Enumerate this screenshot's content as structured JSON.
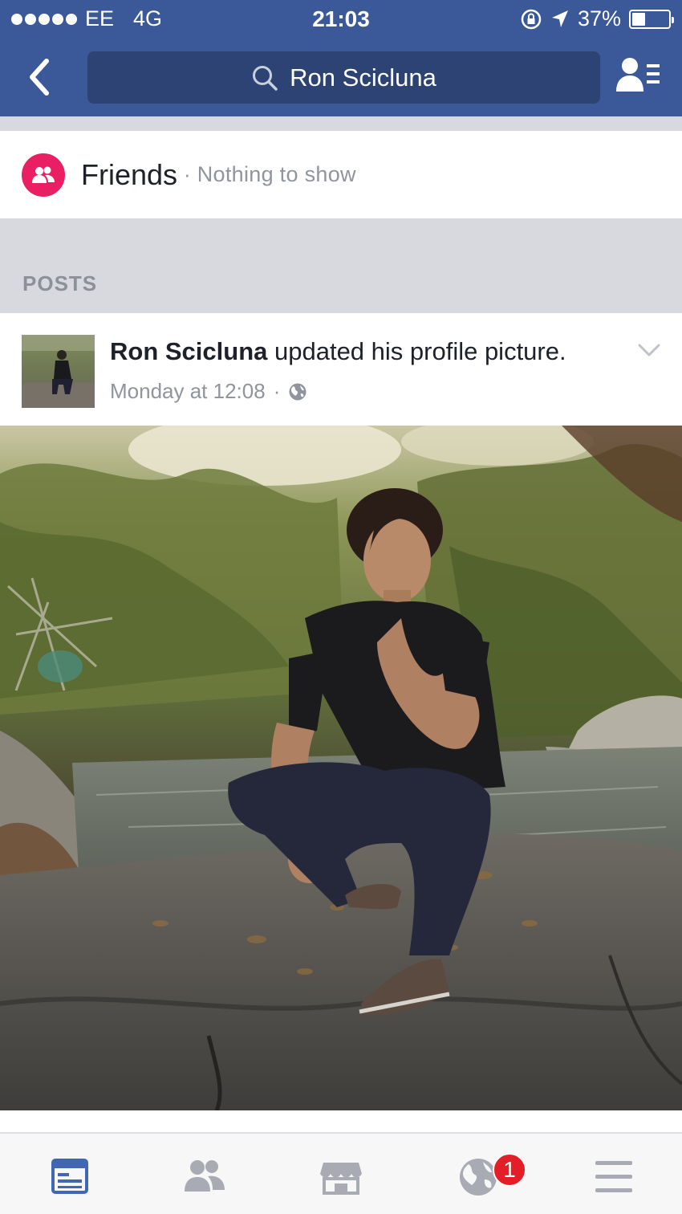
{
  "status_bar": {
    "carrier": "EE",
    "network": "4G",
    "time": "21:03",
    "battery": "37%",
    "battery_level": 0.37
  },
  "nav": {
    "search_query": "Ron Scicluna"
  },
  "friends": {
    "title": "Friends",
    "separator": "·",
    "subtitle": "Nothing to show",
    "icon": "friends-icon"
  },
  "section": {
    "posts_label": "POSTS"
  },
  "post": {
    "author": "Ron Scicluna",
    "action": " updated his profile picture.",
    "timestamp": "Monday at 12:08",
    "meta_separator": "·",
    "privacy_icon": "globe-icon"
  },
  "tabbar": {
    "items": [
      "news-feed-icon",
      "friends-requests-icon",
      "marketplace-icon",
      "notifications-globe-icon",
      "menu-icon"
    ],
    "notifications_badge": "1"
  },
  "colors": {
    "header_blue": "#3b5998",
    "search_bg": "#2d4373",
    "friends_accent": "#e91e63",
    "badge_red": "#e41e26",
    "active_tab": "#4267b2",
    "inactive_tab": "#a8abb3"
  }
}
